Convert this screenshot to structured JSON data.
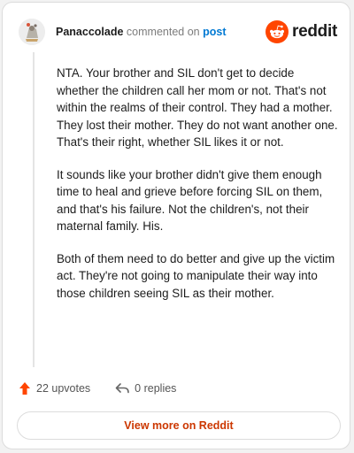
{
  "comment": {
    "username": "Panaccolade",
    "action_text": "commented on",
    "link_text": "post",
    "paragraphs": [
      "NTA. Your brother and SIL don't get to decide whether the children call her mom or not. That's not within the realms of their control. They had a mother. They lost their mother. They do not want another one. That's their right, whether SIL likes it or not.",
      "It sounds like your brother didn't give them enough time to heal and grieve before forcing SIL on them, and that's his failure. Not the children's, not their maternal family. His.",
      "Both of them need to do better and give up the victim act. They're not going to manipulate their way into those children seeing SIL as their mother."
    ],
    "upvotes_label": "22 upvotes",
    "replies_label": "0 replies"
  },
  "brand": {
    "name": "reddit",
    "accent_color": "#ff4500"
  },
  "footer": {
    "view_more_label": "View more on Reddit"
  },
  "icons": {
    "avatar": "user-avatar",
    "logo": "reddit-logo-icon",
    "upvote": "upvote-arrow-icon",
    "reply": "reply-arrow-icon"
  }
}
